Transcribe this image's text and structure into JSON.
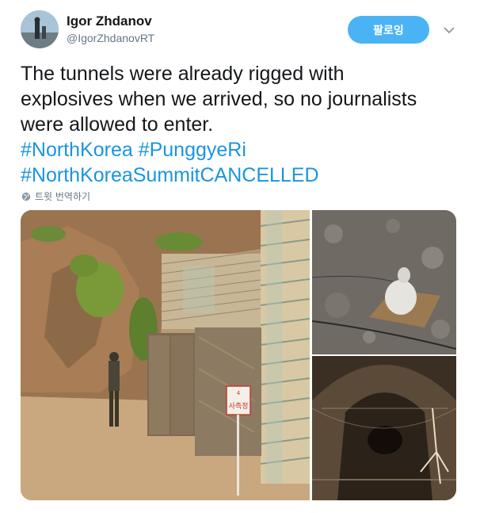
{
  "user": {
    "display_name": "Igor Zhdanov",
    "handle": "@IgorZhdanovRT"
  },
  "follow_button_label": "팔로잉",
  "icons": {
    "more": "chevron-down-icon",
    "translate": "globe-icon"
  },
  "tweet": {
    "lines": [
      "The tunnels were already rigged with",
      "explosives when we arrived, so no journalists",
      "were allowed to enter."
    ],
    "hashtags_line1": [
      "#NorthKorea",
      "#PunggyeRi"
    ],
    "hashtags_line2": [
      "#NorthKoreaSummitCANCELLED"
    ]
  },
  "translate_label": "트윗 번역하기",
  "media": {
    "photo1_sign_text": "4 사측정"
  },
  "colors": {
    "accent": "#1b95e0",
    "follow_button": "#4ab3f4",
    "muted_text": "#657786"
  }
}
